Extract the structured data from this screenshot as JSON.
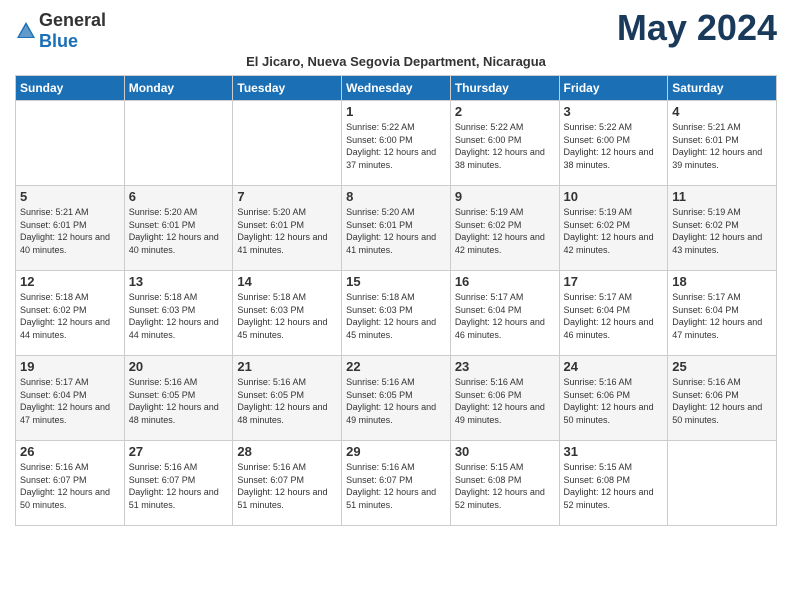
{
  "logo": {
    "general": "General",
    "blue": "Blue"
  },
  "title": "May 2024",
  "subtitle": "El Jicaro, Nueva Segovia Department, Nicaragua",
  "days_of_week": [
    "Sunday",
    "Monday",
    "Tuesday",
    "Wednesday",
    "Thursday",
    "Friday",
    "Saturday"
  ],
  "weeks": [
    [
      {
        "day": "",
        "sunrise": "",
        "sunset": "",
        "daylight": ""
      },
      {
        "day": "",
        "sunrise": "",
        "sunset": "",
        "daylight": ""
      },
      {
        "day": "",
        "sunrise": "",
        "sunset": "",
        "daylight": ""
      },
      {
        "day": "1",
        "sunrise": "Sunrise: 5:22 AM",
        "sunset": "Sunset: 6:00 PM",
        "daylight": "Daylight: 12 hours and 37 minutes."
      },
      {
        "day": "2",
        "sunrise": "Sunrise: 5:22 AM",
        "sunset": "Sunset: 6:00 PM",
        "daylight": "Daylight: 12 hours and 38 minutes."
      },
      {
        "day": "3",
        "sunrise": "Sunrise: 5:22 AM",
        "sunset": "Sunset: 6:00 PM",
        "daylight": "Daylight: 12 hours and 38 minutes."
      },
      {
        "day": "4",
        "sunrise": "Sunrise: 5:21 AM",
        "sunset": "Sunset: 6:01 PM",
        "daylight": "Daylight: 12 hours and 39 minutes."
      }
    ],
    [
      {
        "day": "5",
        "sunrise": "Sunrise: 5:21 AM",
        "sunset": "Sunset: 6:01 PM",
        "daylight": "Daylight: 12 hours and 40 minutes."
      },
      {
        "day": "6",
        "sunrise": "Sunrise: 5:20 AM",
        "sunset": "Sunset: 6:01 PM",
        "daylight": "Daylight: 12 hours and 40 minutes."
      },
      {
        "day": "7",
        "sunrise": "Sunrise: 5:20 AM",
        "sunset": "Sunset: 6:01 PM",
        "daylight": "Daylight: 12 hours and 41 minutes."
      },
      {
        "day": "8",
        "sunrise": "Sunrise: 5:20 AM",
        "sunset": "Sunset: 6:01 PM",
        "daylight": "Daylight: 12 hours and 41 minutes."
      },
      {
        "day": "9",
        "sunrise": "Sunrise: 5:19 AM",
        "sunset": "Sunset: 6:02 PM",
        "daylight": "Daylight: 12 hours and 42 minutes."
      },
      {
        "day": "10",
        "sunrise": "Sunrise: 5:19 AM",
        "sunset": "Sunset: 6:02 PM",
        "daylight": "Daylight: 12 hours and 42 minutes."
      },
      {
        "day": "11",
        "sunrise": "Sunrise: 5:19 AM",
        "sunset": "Sunset: 6:02 PM",
        "daylight": "Daylight: 12 hours and 43 minutes."
      }
    ],
    [
      {
        "day": "12",
        "sunrise": "Sunrise: 5:18 AM",
        "sunset": "Sunset: 6:02 PM",
        "daylight": "Daylight: 12 hours and 44 minutes."
      },
      {
        "day": "13",
        "sunrise": "Sunrise: 5:18 AM",
        "sunset": "Sunset: 6:03 PM",
        "daylight": "Daylight: 12 hours and 44 minutes."
      },
      {
        "day": "14",
        "sunrise": "Sunrise: 5:18 AM",
        "sunset": "Sunset: 6:03 PM",
        "daylight": "Daylight: 12 hours and 45 minutes."
      },
      {
        "day": "15",
        "sunrise": "Sunrise: 5:18 AM",
        "sunset": "Sunset: 6:03 PM",
        "daylight": "Daylight: 12 hours and 45 minutes."
      },
      {
        "day": "16",
        "sunrise": "Sunrise: 5:17 AM",
        "sunset": "Sunset: 6:04 PM",
        "daylight": "Daylight: 12 hours and 46 minutes."
      },
      {
        "day": "17",
        "sunrise": "Sunrise: 5:17 AM",
        "sunset": "Sunset: 6:04 PM",
        "daylight": "Daylight: 12 hours and 46 minutes."
      },
      {
        "day": "18",
        "sunrise": "Sunrise: 5:17 AM",
        "sunset": "Sunset: 6:04 PM",
        "daylight": "Daylight: 12 hours and 47 minutes."
      }
    ],
    [
      {
        "day": "19",
        "sunrise": "Sunrise: 5:17 AM",
        "sunset": "Sunset: 6:04 PM",
        "daylight": "Daylight: 12 hours and 47 minutes."
      },
      {
        "day": "20",
        "sunrise": "Sunrise: 5:16 AM",
        "sunset": "Sunset: 6:05 PM",
        "daylight": "Daylight: 12 hours and 48 minutes."
      },
      {
        "day": "21",
        "sunrise": "Sunrise: 5:16 AM",
        "sunset": "Sunset: 6:05 PM",
        "daylight": "Daylight: 12 hours and 48 minutes."
      },
      {
        "day": "22",
        "sunrise": "Sunrise: 5:16 AM",
        "sunset": "Sunset: 6:05 PM",
        "daylight": "Daylight: 12 hours and 49 minutes."
      },
      {
        "day": "23",
        "sunrise": "Sunrise: 5:16 AM",
        "sunset": "Sunset: 6:06 PM",
        "daylight": "Daylight: 12 hours and 49 minutes."
      },
      {
        "day": "24",
        "sunrise": "Sunrise: 5:16 AM",
        "sunset": "Sunset: 6:06 PM",
        "daylight": "Daylight: 12 hours and 50 minutes."
      },
      {
        "day": "25",
        "sunrise": "Sunrise: 5:16 AM",
        "sunset": "Sunset: 6:06 PM",
        "daylight": "Daylight: 12 hours and 50 minutes."
      }
    ],
    [
      {
        "day": "26",
        "sunrise": "Sunrise: 5:16 AM",
        "sunset": "Sunset: 6:07 PM",
        "daylight": "Daylight: 12 hours and 50 minutes."
      },
      {
        "day": "27",
        "sunrise": "Sunrise: 5:16 AM",
        "sunset": "Sunset: 6:07 PM",
        "daylight": "Daylight: 12 hours and 51 minutes."
      },
      {
        "day": "28",
        "sunrise": "Sunrise: 5:16 AM",
        "sunset": "Sunset: 6:07 PM",
        "daylight": "Daylight: 12 hours and 51 minutes."
      },
      {
        "day": "29",
        "sunrise": "Sunrise: 5:16 AM",
        "sunset": "Sunset: 6:07 PM",
        "daylight": "Daylight: 12 hours and 51 minutes."
      },
      {
        "day": "30",
        "sunrise": "Sunrise: 5:15 AM",
        "sunset": "Sunset: 6:08 PM",
        "daylight": "Daylight: 12 hours and 52 minutes."
      },
      {
        "day": "31",
        "sunrise": "Sunrise: 5:15 AM",
        "sunset": "Sunset: 6:08 PM",
        "daylight": "Daylight: 12 hours and 52 minutes."
      },
      {
        "day": "",
        "sunrise": "",
        "sunset": "",
        "daylight": ""
      }
    ]
  ]
}
